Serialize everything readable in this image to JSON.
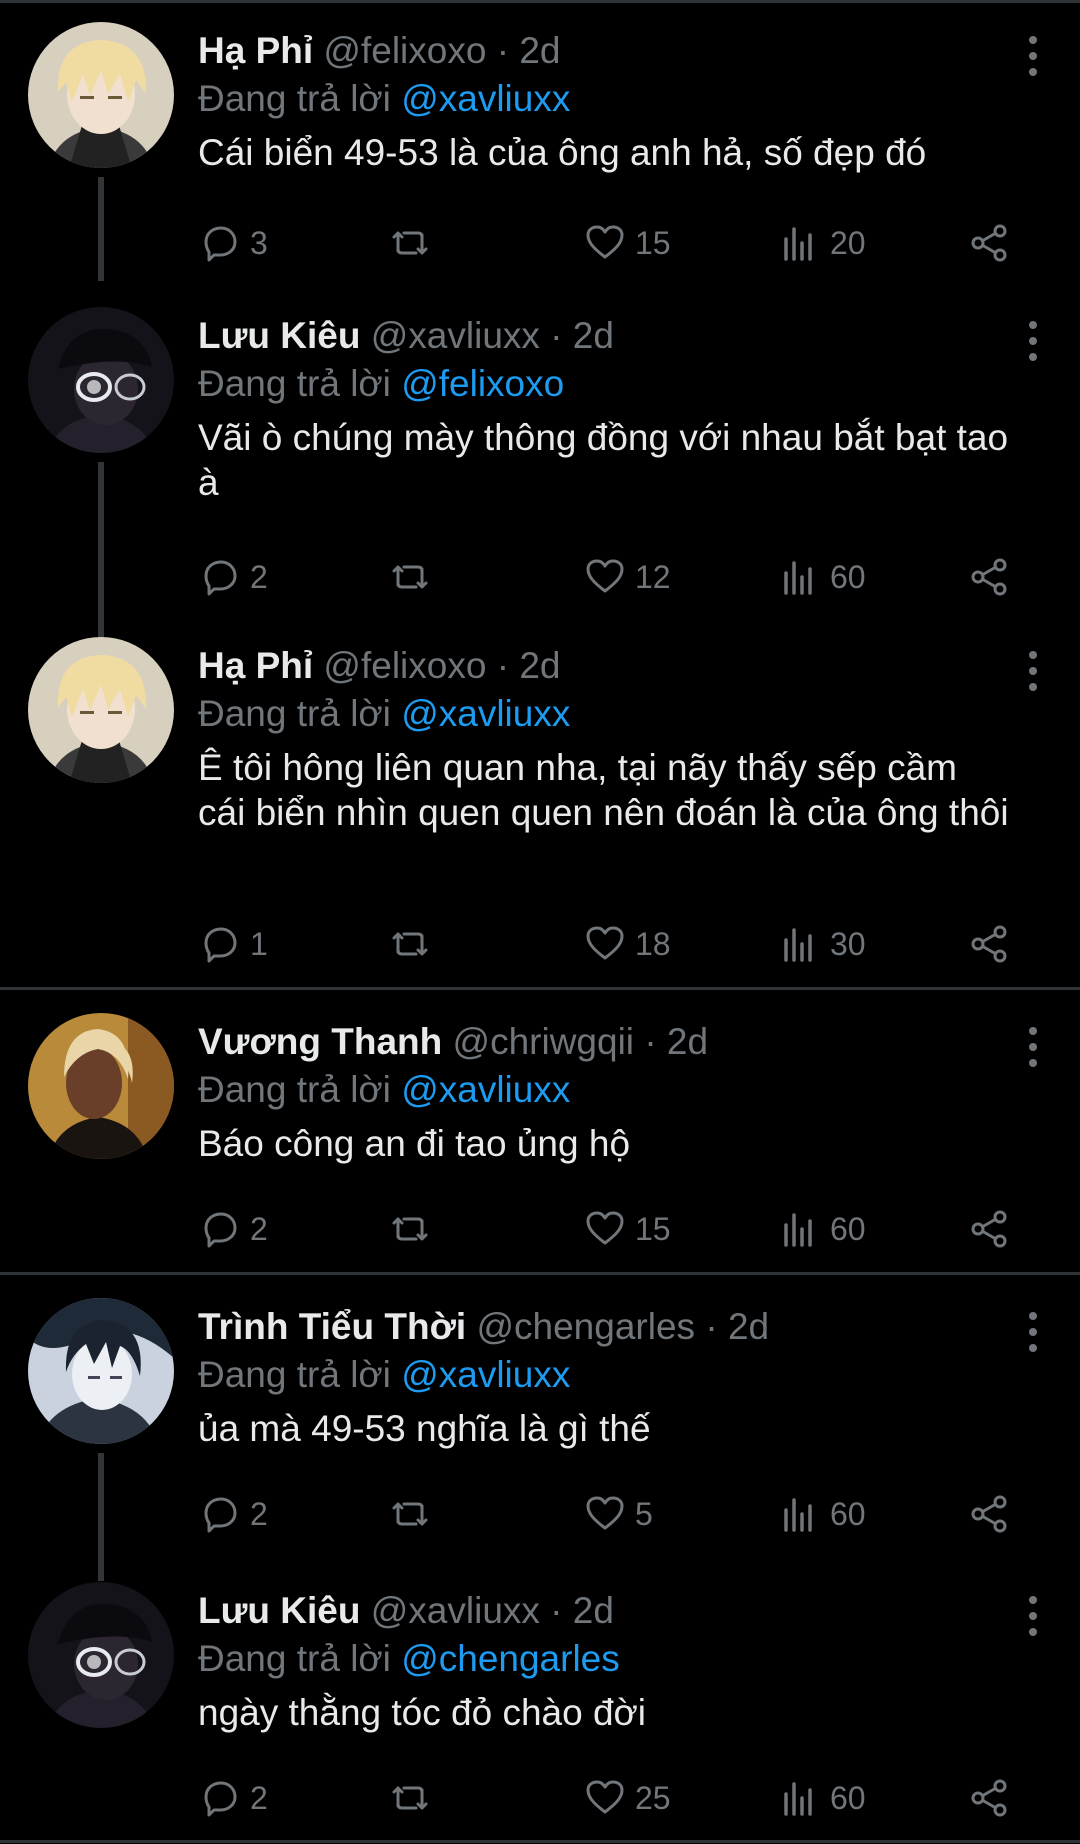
{
  "reply_prefix": "Đang trả lời",
  "tweets": [
    {
      "name": "Hạ Phỉ",
      "handle": "@felixoxo",
      "time": "2d",
      "reply_to": "@xavliuxx",
      "text": "Cái biển 49-53 là của ông anh hả, số đẹp đó",
      "replies": "3",
      "retweets": "",
      "likes": "15",
      "views": "20",
      "avatar": "blond-anime-avatar"
    },
    {
      "name": "Lưu Kiêu",
      "handle": "@xavliuxx",
      "time": "2d",
      "reply_to": "@felixoxo",
      "text": "Vãi ò chúng mày thông đồng với nhau bắt bạt tao à",
      "replies": "2",
      "retweets": "",
      "likes": "12",
      "views": "60",
      "avatar": "dark-hat-glasses-avatar"
    },
    {
      "name": "Hạ Phỉ",
      "handle": "@felixoxo",
      "time": "2d",
      "reply_to": "@xavliuxx",
      "text": "Ê tôi hông liên quan nha, tại nãy thấy sếp cầm cái biển nhìn quen quen nên đoán là của ông thôi",
      "replies": "1",
      "retweets": "",
      "likes": "18",
      "views": "30",
      "avatar": "blond-anime-avatar"
    },
    {
      "name": "Vương Thanh",
      "handle": "@chriwgqii",
      "time": "2d",
      "reply_to": "@xavliuxx",
      "text": "Báo công an đi tao ủng hộ",
      "replies": "2",
      "retweets": "",
      "likes": "15",
      "views": "60",
      "avatar": "gold-portrait-avatar"
    },
    {
      "name": "Trình Tiểu Thời",
      "handle": "@chengarles",
      "time": "2d",
      "reply_to": "@xavliuxx",
      "text": "ủa mà 49-53 nghĩa là gì thế",
      "replies": "2",
      "retweets": "",
      "likes": "5",
      "views": "60",
      "avatar": "dark-hair-avatar"
    },
    {
      "name": "Lưu Kiêu",
      "handle": "@xavliuxx",
      "time": "2d",
      "reply_to": "@chengarles",
      "text": "ngày thằng tóc đỏ chào đời",
      "replies": "2",
      "retweets": "",
      "likes": "25",
      "views": "60",
      "avatar": "dark-hat-glasses-avatar"
    }
  ],
  "icons": {
    "reply": "reply-icon",
    "retweet": "retweet-icon",
    "like": "heart-icon",
    "views": "views-icon",
    "share": "share-icon",
    "more": "more-icon"
  },
  "colors": {
    "background": "#000000",
    "text": "#e7e9ea",
    "secondary": "#71767b",
    "mention": "#1d9bf0",
    "divider": "#2f3336"
  }
}
